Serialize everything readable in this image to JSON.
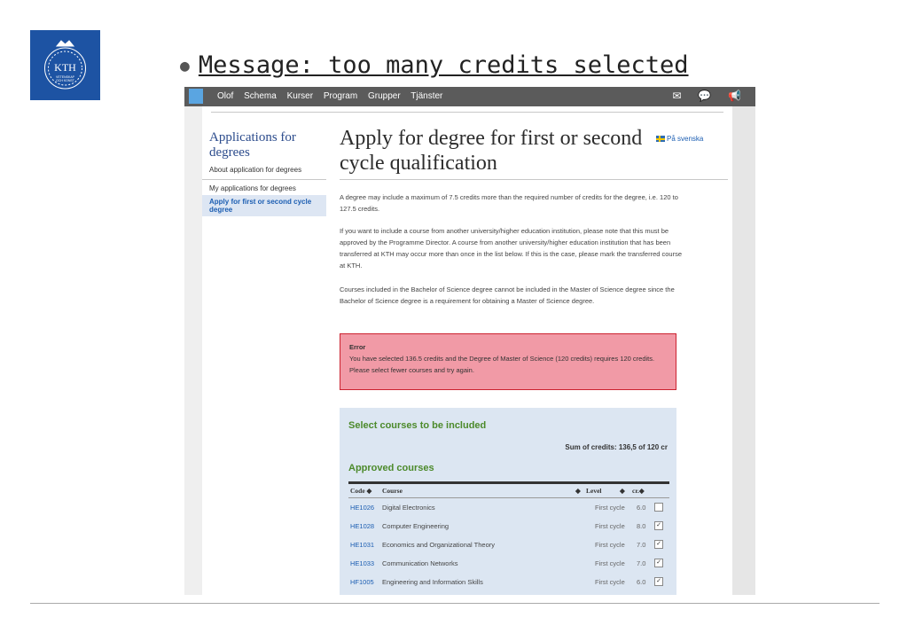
{
  "slide": {
    "title": "Message: too many credits selected",
    "logo": {
      "text_main": "KTH",
      "text_sub1": "VETENSKAP",
      "text_sub2": "OCH KONST",
      "color": "#1d53a3"
    }
  },
  "topbar": {
    "nav": [
      "Olof",
      "Schema",
      "Kurser",
      "Program",
      "Grupper",
      "Tjänster"
    ],
    "icons": [
      "mail-icon",
      "chat-icon",
      "megaphone-icon"
    ]
  },
  "sidebar": {
    "heading": "Applications for degrees",
    "items": [
      {
        "label": "About application for degrees"
      },
      {
        "label": "My applications for degrees"
      },
      {
        "label": "Apply for first or second cycle degree"
      }
    ]
  },
  "main": {
    "title": "Apply for degree for first or second cycle qualification",
    "lang_link": "På svenska",
    "paragraphs": [
      "A degree may include a maximum of 7.5 credits more than the required number of credits for the degree, i.e. 120 to 127.5 credits.",
      "If you want to include a course from another university/higher education institution, please note that this must be approved by the Programme Director. A course from another university/higher education institution that has been transferred at KTH may occur more than once in the list below. If this is the case, please mark the transferred course at KTH.",
      "Courses included in the Bachelor of Science degree cannot be included in the Master of Science degree since the Bachelor of Science degree is a requirement for obtaining a Master of Science degree."
    ],
    "error": {
      "title": "Error",
      "message": "You have selected 136.5 credits and the Degree of Master of Science (120 credits) requires 120 credits. Please select fewer courses and try again."
    }
  },
  "panel": {
    "title": "Select courses to be included",
    "sum": "Sum of credits: 136,5 of 120 cr",
    "approved_title": "Approved courses",
    "columns": {
      "code": "Code ◆",
      "course": "Course",
      "level_sort": "◆",
      "level": "Level",
      "cr_sort": "◆",
      "cr": "cr.◆"
    },
    "rows": [
      {
        "code": "HE1026",
        "course": "Digital Electronics",
        "level": "First cycle",
        "cr": "6.0",
        "checked": ""
      },
      {
        "code": "HE1028",
        "course": "Computer Engineering",
        "level": "First cycle",
        "cr": "8.0",
        "checked": "✓"
      },
      {
        "code": "HE1031",
        "course": "Economics and Organizational Theory",
        "level": "First cycle",
        "cr": "7.0",
        "checked": "✓"
      },
      {
        "code": "HE1033",
        "course": "Communication Networks",
        "level": "First cycle",
        "cr": "7.0",
        "checked": "✓"
      },
      {
        "code": "HF1005",
        "course": "Engineering and Information Skills",
        "level": "First cycle",
        "cr": "6.0",
        "checked": "✓"
      }
    ]
  }
}
